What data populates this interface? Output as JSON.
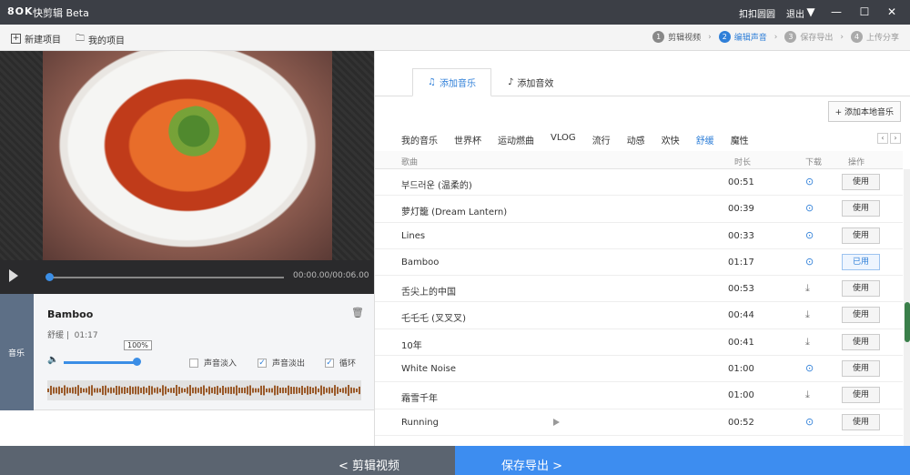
{
  "titlebar": {
    "logo": "8OK",
    "app_name": "快剪辑 Beta",
    "links": [
      "扣扣圆圆",
      "退出"
    ],
    "window_buttons": [
      "menu",
      "minimize",
      "maximize",
      "close"
    ]
  },
  "toolbar": {
    "new_project": "新建项目",
    "my_projects": "我的项目",
    "steps": [
      {
        "num": "1",
        "label": "剪辑视频"
      },
      {
        "num": "2",
        "label": "编辑声音"
      },
      {
        "num": "3",
        "label": "保存导出"
      },
      {
        "num": "4",
        "label": "上传分享"
      }
    ]
  },
  "player": {
    "time": "00:00.00/00:06.00",
    "progress": 0.0
  },
  "music_panel": {
    "tab_label": "音乐",
    "song_title": "Bamboo",
    "song_category": "舒缓",
    "song_duration": "01:17",
    "volume_tip": "100%",
    "volume": 1.0,
    "fade_in_label": "声音淡入",
    "fade_in_checked": false,
    "fade_out_label": "声音淡出",
    "fade_out_checked": true,
    "loop_label": "循环",
    "loop_checked": true
  },
  "bottom": {
    "back_label": "< 剪辑视频",
    "save_label": "保存导出 >"
  },
  "right": {
    "tab_music": "添加音乐",
    "tab_effects": "添加音效",
    "add_local": "+ 添加本地音乐",
    "categories": [
      "我的音乐",
      "世界杯",
      "运动燃曲",
      "VLOG",
      "流行",
      "动感",
      "欢快",
      "舒缓",
      "魔性"
    ],
    "active_category": "舒缓",
    "columns": {
      "song": "歌曲",
      "duration": "时长",
      "download": "下载",
      "action": "操作"
    },
    "songs": [
      {
        "name": "부드러운 (温柔的)",
        "duration": "00:51",
        "downloaded": true,
        "action": "使用"
      },
      {
        "name": "萝灯籠 (Dream Lantern)",
        "duration": "00:39",
        "downloaded": true,
        "action": "使用"
      },
      {
        "name": "Lines",
        "duration": "00:33",
        "downloaded": true,
        "action": "使用"
      },
      {
        "name": "Bamboo",
        "duration": "01:17",
        "downloaded": true,
        "action": "已用"
      },
      {
        "name": "舌尖上的中国",
        "duration": "00:53",
        "downloaded": false,
        "action": "使用"
      },
      {
        "name": "乇乇乇 (叉叉叉)",
        "duration": "00:44",
        "downloaded": false,
        "action": "使用"
      },
      {
        "name": "10年",
        "duration": "00:41",
        "downloaded": false,
        "action": "使用"
      },
      {
        "name": "White Noise",
        "duration": "01:00",
        "downloaded": true,
        "action": "使用"
      },
      {
        "name": "霜雪千年",
        "duration": "01:00",
        "downloaded": false,
        "action": "使用"
      },
      {
        "name": "Running",
        "duration": "00:52",
        "downloaded": true,
        "action": "使用"
      }
    ]
  }
}
